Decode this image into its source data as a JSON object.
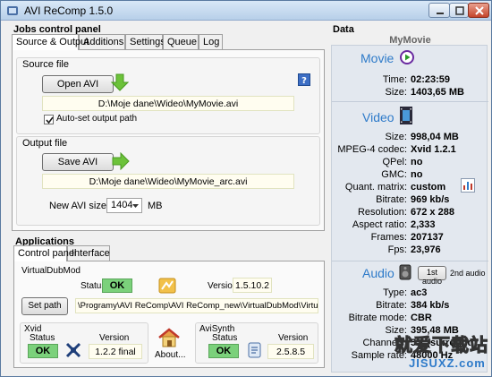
{
  "window": {
    "title": "AVI ReComp  1.5.0"
  },
  "jobs": {
    "title": "Jobs control panel",
    "tabs": [
      "Source & Output",
      "Additions",
      "Settings",
      "Queue",
      "Log"
    ],
    "source": {
      "label": "Source file",
      "open_button": "Open AVI",
      "path": "D:\\Moje dane\\Wideo\\MyMovie.avi",
      "autoset_label": "Auto-set output path",
      "autoset_checked": true
    },
    "output": {
      "label": "Output file",
      "save_button": "Save AVI",
      "path": "D:\\Moje dane\\Wideo\\MyMovie_arc.avi",
      "size_label": "New AVI size =",
      "size_value": "1404",
      "size_unit": "MB"
    }
  },
  "applications": {
    "title": "Applications",
    "tabs": [
      "Control panel",
      "Interface"
    ],
    "virtualdubmod": {
      "title": "VirtualDubMod",
      "status_label": "Status",
      "status": "OK",
      "version_label": "Version",
      "version": "1.5.10.2",
      "setpath_button": "Set path",
      "path": "\\Programy\\AVI ReComp\\AVI ReComp_new\\VirtualDubMod\\VirtualDubMod.exe"
    },
    "xvid": {
      "title": "Xvid",
      "status_label": "Status",
      "status": "OK",
      "version_label": "Version",
      "version": "1.2.2 final"
    },
    "about_label": "About...",
    "avisynth": {
      "title": "AviSynth",
      "status_label": "Status",
      "status": "OK",
      "version_label": "Version",
      "version": "2.5.8.5"
    }
  },
  "data": {
    "title": "Data",
    "movie_name": "MyMovie",
    "movie": {
      "heading": "Movie",
      "time_label": "Time:",
      "time": "02:23:59",
      "size_label": "Size:",
      "size": "1403,65 MB"
    },
    "video": {
      "heading": "Video",
      "rows": [
        {
          "label": "Size:",
          "value": "998,04 MB"
        },
        {
          "label": "MPEG-4 codec:",
          "value": "Xvid 1.2.1"
        },
        {
          "label": "QPel:",
          "value": "no"
        },
        {
          "label": "GMC:",
          "value": "no"
        },
        {
          "label": "Quant. matrix:",
          "value": "custom"
        },
        {
          "label": "Bitrate:",
          "value": "969 kb/s"
        },
        {
          "label": "Resolution:",
          "value": "672 x 288"
        },
        {
          "label": "Aspect ratio:",
          "value": "2,333"
        },
        {
          "label": "Frames:",
          "value": "207137"
        },
        {
          "label": "Fps:",
          "value": "23,976"
        }
      ]
    },
    "audio": {
      "heading": "Audio",
      "track_1": "1st audio",
      "track_2": "2nd audio",
      "rows": [
        {
          "label": "Type:",
          "value": "ac3"
        },
        {
          "label": "Bitrate:",
          "value": "384 kb/s"
        },
        {
          "label": "Bitrate mode:",
          "value": "CBR"
        },
        {
          "label": "Size:",
          "value": "395,48 MB"
        },
        {
          "label": "Channels:",
          "value": "5.1 (surround)"
        },
        {
          "label": "Sample rate:",
          "value": "48000 Hz"
        }
      ]
    }
  },
  "watermark": {
    "text_cn": "就爱下载站",
    "text_url": "JISUXZ.com"
  },
  "colors": {
    "accent_blue": "#2d7ac9",
    "ok_green": "#7bd17b",
    "arrow_green": "#6cc23a"
  }
}
